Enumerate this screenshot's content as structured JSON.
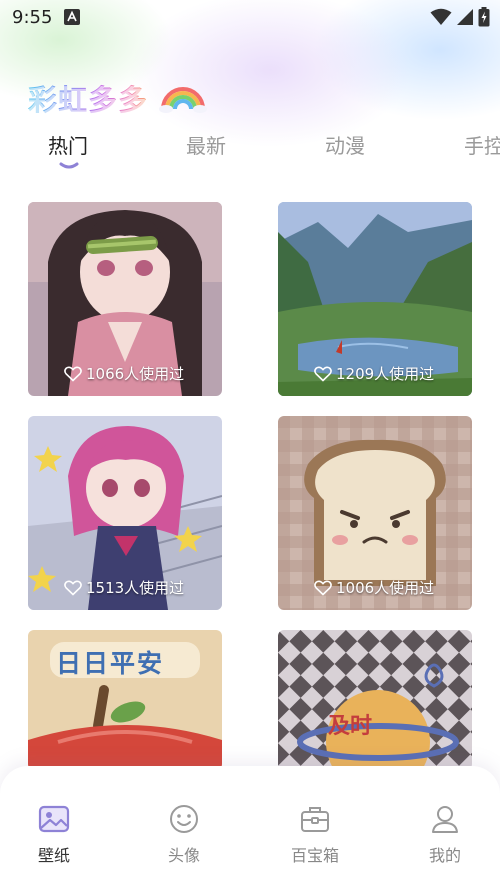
{
  "status_bar": {
    "time": "9:55"
  },
  "app": {
    "title": "彩虹多多",
    "accent_color": "#8e82d6"
  },
  "tabs": [
    {
      "label": "热门",
      "active": true
    },
    {
      "label": "最新",
      "active": false
    },
    {
      "label": "动漫",
      "active": false
    },
    {
      "label": "手控",
      "active": false
    }
  ],
  "wallpapers": [
    {
      "usage": "1066人使用过",
      "subject": "anime girl with bamboo muzzle"
    },
    {
      "usage": "1209人使用过",
      "subject": "mountain lake landscape"
    },
    {
      "usage": "1513人使用过",
      "subject": "pink haired anime girl with stars"
    },
    {
      "usage": "1006人使用过",
      "subject": "angry toast on checkered background"
    },
    {
      "usage": "",
      "subject": "apple illustration",
      "text": "日日平安"
    },
    {
      "usage": "",
      "subject": "planet on checker pattern",
      "text": "及时"
    }
  ],
  "bottom_nav": [
    {
      "label": "壁纸",
      "icon": "image-icon",
      "active": true
    },
    {
      "label": "头像",
      "icon": "smiley-icon",
      "active": false
    },
    {
      "label": "百宝箱",
      "icon": "toolbox-icon",
      "active": false
    },
    {
      "label": "我的",
      "icon": "user-icon",
      "active": false
    }
  ]
}
